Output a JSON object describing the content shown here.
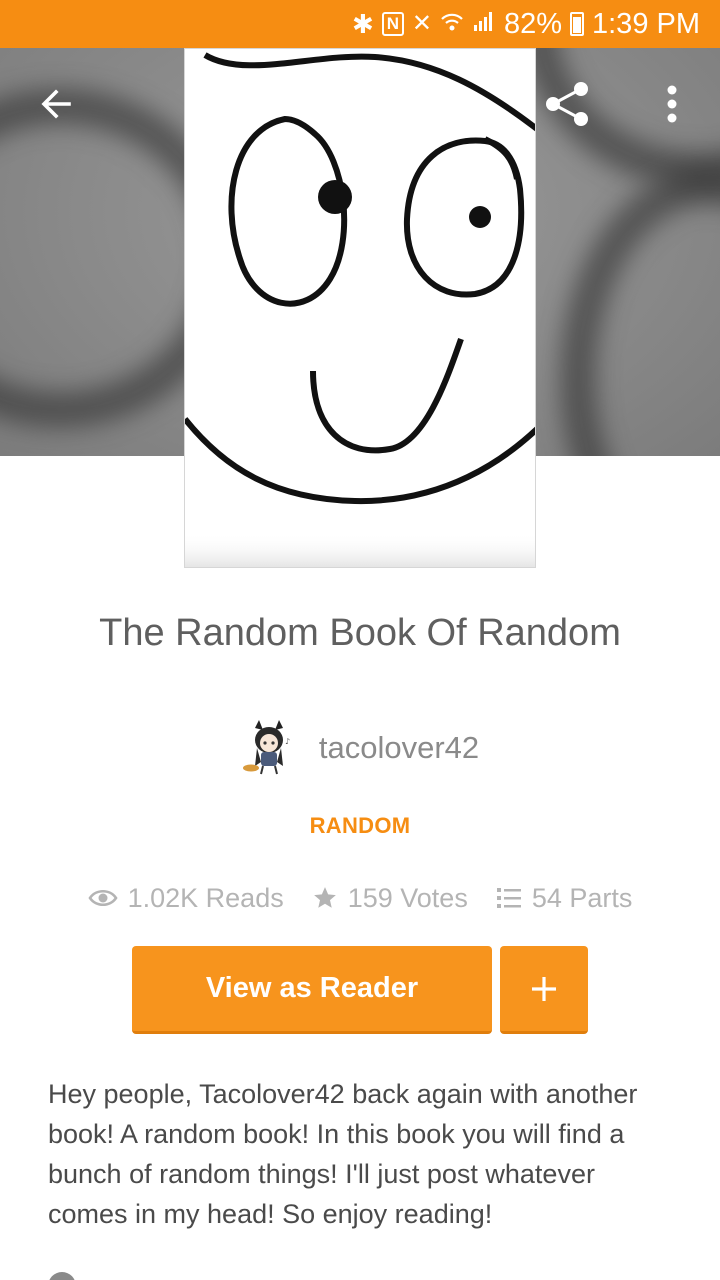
{
  "status_bar": {
    "battery": "82%",
    "time": "1:39 PM",
    "accent": "#f68d12"
  },
  "header": {
    "back_icon": "arrow-left-icon",
    "share_icon": "share-icon",
    "more_icon": "more-vert-icon"
  },
  "story": {
    "title": "The Random Book Of Random",
    "author": "tacolover42",
    "tag": "RANDOM",
    "stats": {
      "reads": "1.02K Reads",
      "votes": "159 Votes",
      "parts": "54 Parts"
    },
    "description": "Hey people, Tacolover42 back again with another book! A random book! In this book you will find a bunch of random things! I'll just post whatever comes in my head! So enjoy reading!"
  },
  "actions": {
    "view_as_reader": "View as Reader",
    "add_label": "+"
  }
}
